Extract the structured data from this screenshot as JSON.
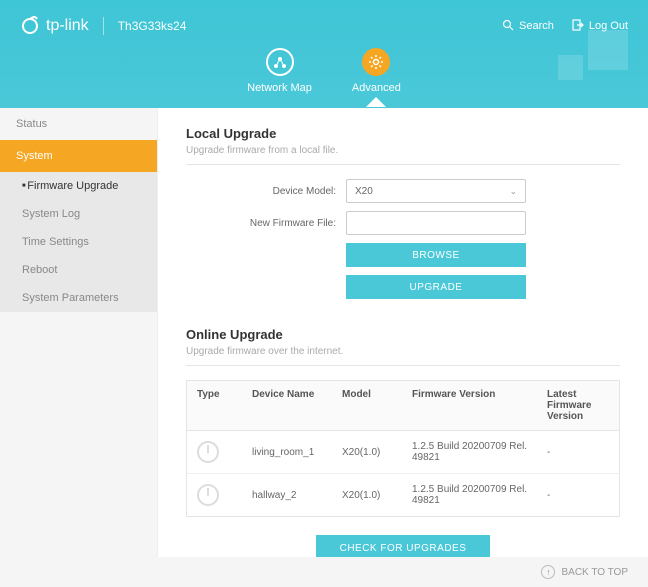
{
  "header": {
    "brand": "tp-link",
    "device_id": "Th3G33ks24",
    "search": "Search",
    "logout": "Log Out"
  },
  "nav": {
    "network_map": "Network Map",
    "advanced": "Advanced"
  },
  "sidebar": {
    "status": "Status",
    "system": "System",
    "sub": {
      "firmware": "Firmware Upgrade",
      "syslog": "System Log",
      "time": "Time Settings",
      "reboot": "Reboot",
      "params": "System Parameters"
    }
  },
  "local": {
    "title": "Local Upgrade",
    "subtitle": "Upgrade firmware from a local file.",
    "device_model_label": "Device Model:",
    "device_model_value": "X20",
    "new_firmware_label": "New Firmware File:",
    "browse": "BROWSE",
    "upgrade": "UPGRADE"
  },
  "online": {
    "title": "Online Upgrade",
    "subtitle": "Upgrade firmware over the internet.",
    "columns": {
      "type": "Type",
      "name": "Device Name",
      "model": "Model",
      "fw": "Firmware Version",
      "latest": "Latest Firmware Version"
    },
    "rows": [
      {
        "name": "living_room_1",
        "model": "X20(1.0)",
        "fw": "1.2.5 Build 20200709 Rel. 49821",
        "latest": "-"
      },
      {
        "name": "hallway_2",
        "model": "X20(1.0)",
        "fw": "1.2.5 Build 20200709 Rel. 49821",
        "latest": "-"
      }
    ],
    "check": "CHECK FOR UPGRADES"
  },
  "footer": {
    "back_to_top": "BACK TO TOP"
  }
}
